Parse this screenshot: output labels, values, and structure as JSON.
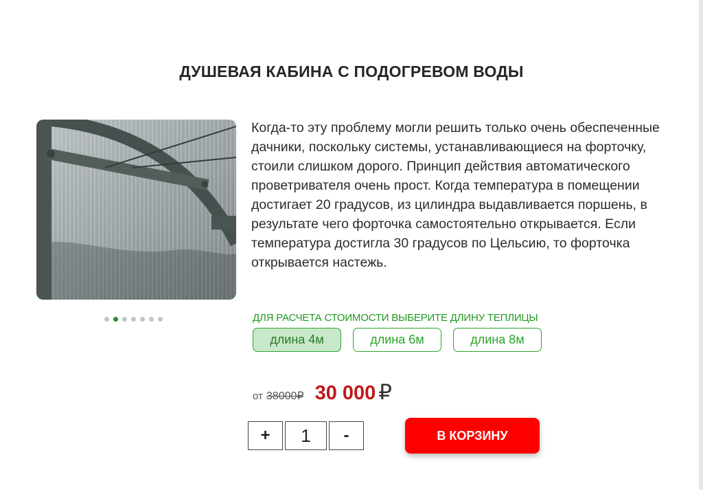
{
  "product": {
    "title": "ДУШЕВАЯ КАБИНА С ПОДОГРЕВОМ ВОДЫ",
    "description": "Когда-то эту проблему могли решить только очень обеспеченные дачники, поскольку системы, устанавливающиеся на форточку, стоили слишком дорого. Принцип действия автоматического проветривателя очень прост. Когда температура в помещении достигает 20 градусов, из цилиндра выдавливается поршень, в результате чего форточка самостоятельно открывается. Если температура достигла 30 градусов по Цельсию, то форточка открывается настежь."
  },
  "gallery": {
    "dot_count": 7,
    "active_dot": 1
  },
  "length_selector": {
    "hint": "ДЛЯ РАСЧЕТА СТОИМОСТИ ВЫБЕРИТЕ ДЛИНУ ТЕПЛИЦЫ",
    "options": [
      {
        "label": "длина 4м",
        "selected": true
      },
      {
        "label": "длина 6м",
        "selected": false
      },
      {
        "label": "длина 8м",
        "selected": false
      }
    ]
  },
  "price": {
    "from_label": "от",
    "old": "38000₽",
    "current": "30 000",
    "currency": "₽"
  },
  "quantity": {
    "plus": "+",
    "value": "1",
    "minus": "-"
  },
  "cart_button": {
    "label": "В КОРЗИНУ"
  },
  "colors": {
    "accent_green": "#2aa52a",
    "price_red": "#c01818",
    "cart_red": "#ff0000"
  }
}
